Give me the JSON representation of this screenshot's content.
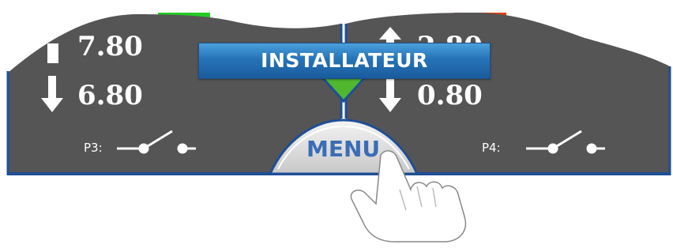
{
  "colors": {
    "panel": "#555555",
    "frame": "#1f4f96",
    "indicator_green": "#22cc22",
    "indicator_red": "#e04010",
    "pointer_green": "#4fb82e",
    "banner_blue": "#2673b8",
    "menu_text": "#3b6db5"
  },
  "left_panel": {
    "up_value": "7.80",
    "down_value": "6.80",
    "switch_label": "P3:"
  },
  "right_panel": {
    "up_value": "2.80",
    "down_value": "0.80",
    "switch_label": "P4:"
  },
  "banner": {
    "label": "INSTALLATEUR"
  },
  "menu": {
    "label": "MENU"
  },
  "icons": [
    "arrow-up-icon",
    "arrow-down-icon",
    "switch-open-icon",
    "hand-pointer-icon"
  ]
}
